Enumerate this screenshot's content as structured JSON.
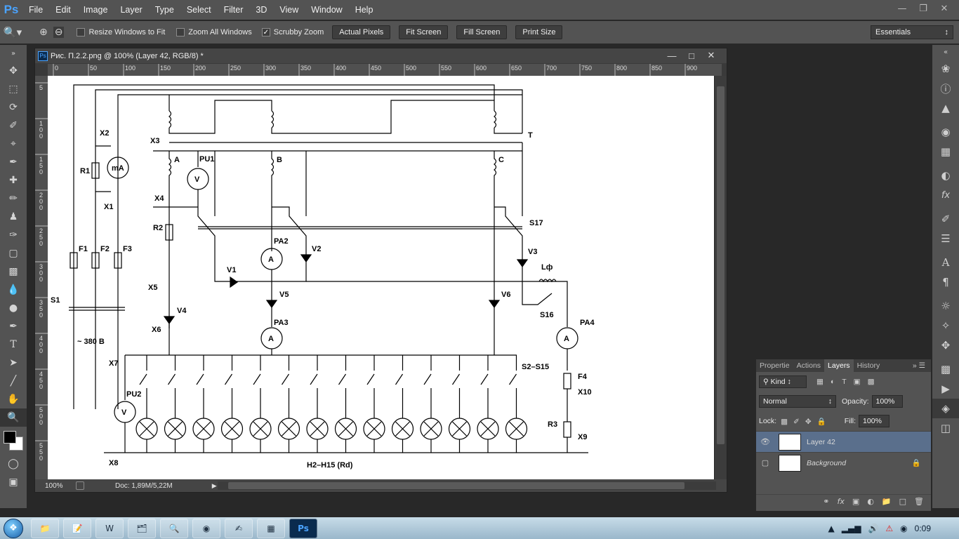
{
  "app": {
    "logo": "Ps"
  },
  "menu": [
    "File",
    "Edit",
    "Image",
    "Layer",
    "Type",
    "Select",
    "Filter",
    "3D",
    "View",
    "Window",
    "Help"
  ],
  "options": {
    "resize_windows": "Resize Windows to Fit",
    "zoom_all": "Zoom All Windows",
    "scrubby": "Scrubby Zoom",
    "actual_pixels": "Actual Pixels",
    "fit_screen": "Fit Screen",
    "fill_screen": "Fill Screen",
    "print_size": "Print Size",
    "workspace": "Essentials"
  },
  "document": {
    "title": "Рис. П.2.2.png @ 100% (Layer 42, RGB/8) *",
    "zoom": "100%",
    "doc_info": "Doc: 1,89M/5,22M",
    "hruler": [
      "0",
      "50",
      "100",
      "150",
      "200",
      "250",
      "300",
      "350",
      "400",
      "450",
      "500",
      "550",
      "600",
      "650",
      "700",
      "750",
      "800",
      "850",
      "900"
    ],
    "vruler": [
      "5",
      "1 0 0",
      "1 5 0",
      "2 0 0",
      "2 5 0",
      "3 0 0",
      "3 5 0",
      "4 0 0",
      "4 5 0",
      "5 0 0",
      "5 5 0"
    ]
  },
  "diagram": {
    "labels": {
      "X2": "X2",
      "X1": "X1",
      "X3": "X3",
      "X4": "X4",
      "X5": "X5",
      "X6": "X6",
      "X7": "X7",
      "X8": "X8",
      "X9": "X9",
      "X10": "X10",
      "R1": "R1",
      "R2": "R2",
      "R3": "R3",
      "mA": "mA",
      "PU1": "PU1",
      "PU2": "PU2",
      "V": "V",
      "A": "A",
      "B": "B",
      "C": "C",
      "T": "T",
      "S17": "S17",
      "S16": "S16",
      "S1": "S1",
      "S2_S15": "S2–S15",
      "PA2": "PA2",
      "PA3": "PA3",
      "PA4": "PA4",
      "amp": "A",
      "V1": "V1",
      "V2": "V2",
      "V3": "V3",
      "V4": "V4",
      "V5": "V5",
      "V6": "V6",
      "F1": "F1",
      "F2": "F2",
      "F3": "F3",
      "F4": "F4",
      "Lf": "Lф",
      "supply": "~ 380 B",
      "lamps": "H2–H15 (Rd)"
    }
  },
  "panel": {
    "tabs": [
      "Propertie",
      "Actions",
      "Layers",
      "History"
    ],
    "kind": "Kind",
    "blend": "Normal",
    "opacity_label": "Opacity:",
    "opacity": "100%",
    "lock_label": "Lock:",
    "fill_label": "Fill:",
    "fill": "100%",
    "layers": [
      {
        "name": "Layer 42",
        "selected": true,
        "visible": true
      },
      {
        "name": "Background",
        "selected": false,
        "visible": false
      }
    ]
  },
  "taskbar": {
    "clock": "0:09"
  }
}
